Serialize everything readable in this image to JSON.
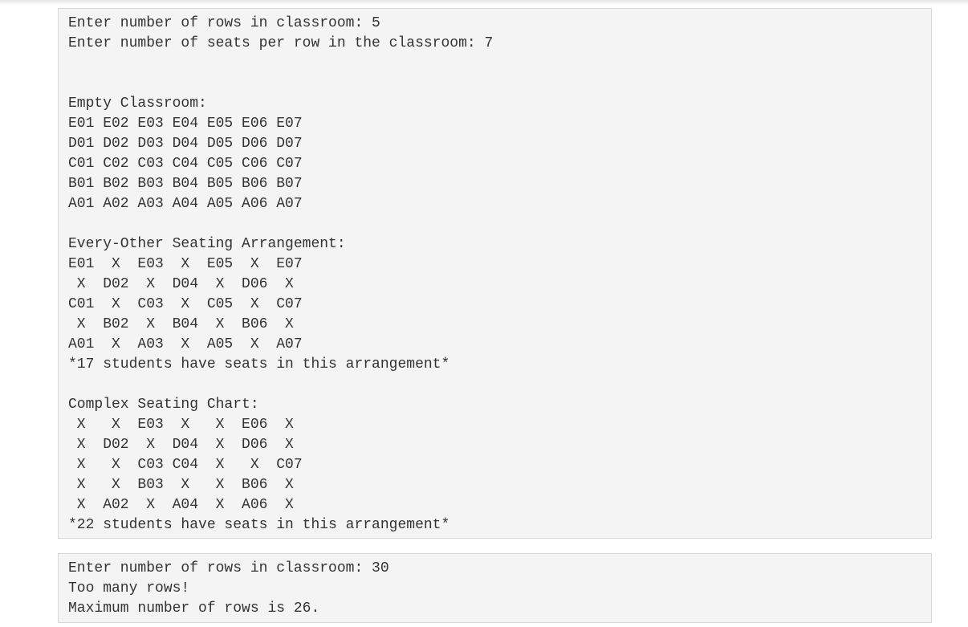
{
  "outputs": [
    {
      "lines": [
        "Enter number of rows in classroom: 5",
        "Enter number of seats per row in the classroom: 7",
        "",
        "",
        "Empty Classroom:",
        "E01 E02 E03 E04 E05 E06 E07",
        "D01 D02 D03 D04 D05 D06 D07",
        "C01 C02 C03 C04 C05 C06 C07",
        "B01 B02 B03 B04 B05 B06 B07",
        "A01 A02 A03 A04 A05 A06 A07",
        "",
        "Every-Other Seating Arrangement:",
        "E01  X  E03  X  E05  X  E07",
        " X  D02  X  D04  X  D06  X",
        "C01  X  C03  X  C05  X  C07",
        " X  B02  X  B04  X  B06  X",
        "A01  X  A03  X  A05  X  A07",
        "*17 students have seats in this arrangement*",
        "",
        "Complex Seating Chart:",
        " X   X  E03  X   X  E06  X",
        " X  D02  X  D04  X  D06  X",
        " X   X  C03 C04  X   X  C07",
        " X   X  B03  X   X  B06  X",
        " X  A02  X  A04  X  A06  X",
        "*22 students have seats in this arrangement*"
      ]
    },
    {
      "lines": [
        "Enter number of rows in classroom: 30",
        "Too many rows!",
        "Maximum number of rows is 26."
      ]
    }
  ]
}
